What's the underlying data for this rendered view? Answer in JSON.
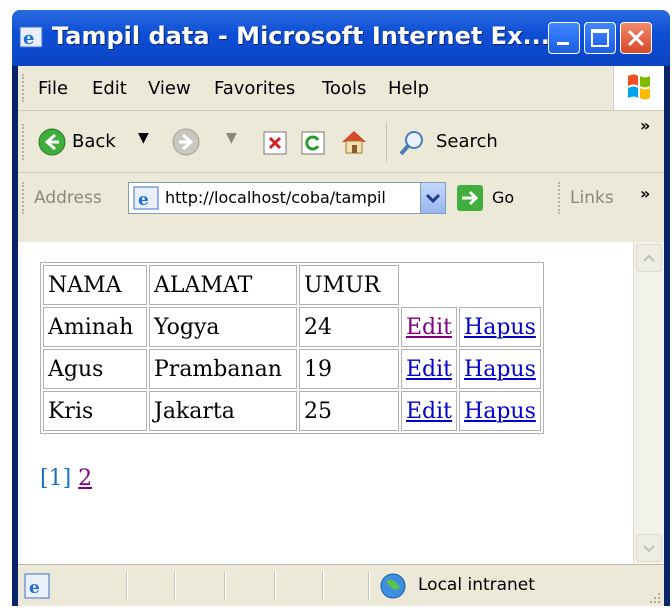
{
  "window": {
    "title": "Tampil data - Microsoft Internet Ex..."
  },
  "menu": [
    "File",
    "Edit",
    "View",
    "Favorites",
    "Tools",
    "Help"
  ],
  "toolbar": {
    "back_label": "Back",
    "search_label": "Search",
    "overflow": "»"
  },
  "address": {
    "label": "Address",
    "url": "http://localhost/coba/tampil",
    "go_label": "Go",
    "links_label": "Links",
    "overflow": "»"
  },
  "table": {
    "headers": [
      "NAMA",
      "ALAMAT",
      "UMUR"
    ],
    "rows": [
      {
        "nama": "Aminah",
        "alamat": "Yogya",
        "umur": "24",
        "edit": "Edit",
        "hapus": "Hapus"
      },
      {
        "nama": "Agus",
        "alamat": "Prambanan",
        "umur": "19",
        "edit": "Edit",
        "hapus": "Hapus"
      },
      {
        "nama": "Kris",
        "alamat": "Jakarta",
        "umur": "25",
        "edit": "Edit",
        "hapus": "Hapus"
      }
    ]
  },
  "pagination": {
    "current": "[1]",
    "next": "2"
  },
  "status": {
    "zone": "Local intranet"
  },
  "colors": {
    "titlebar": "#0f4fd6",
    "chrome": "#ece9d8",
    "link": "#0000cc",
    "visited": "#800080",
    "current_page": "#1a73c8"
  },
  "icons": [
    "ie-icon",
    "minimize-icon",
    "maximize-icon",
    "close-icon",
    "windows-logo-icon",
    "back-icon",
    "forward-icon",
    "stop-icon",
    "refresh-icon",
    "home-icon",
    "search-icon",
    "page-icon",
    "go-icon",
    "intranet-icon",
    "resize-grip-icon"
  ]
}
